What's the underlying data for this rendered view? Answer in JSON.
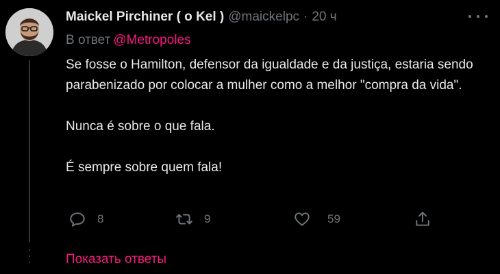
{
  "author": {
    "display_name": "Maickel Pirchiner ( o Kel )",
    "handle": "@maickelpc",
    "separator": "·",
    "time": "20 ч"
  },
  "reply": {
    "prefix": "В ответ",
    "mention": "@Metropoles"
  },
  "body": {
    "line1": "Se fosse o Hamilton, defensor da igualdade e da justiça, estaria sendo parabenizado por colocar a mulher como a melhor \"compra da vida\".",
    "line2": "Nunca é sobre o que fala.",
    "line3": "É sempre sobre quem fala!"
  },
  "actions": {
    "replies": "8",
    "retweets": "9",
    "likes": "59"
  },
  "footer": {
    "show_replies": "Показать ответы"
  },
  "icons": {
    "more": "more-horizontal-icon",
    "reply": "reply-bubble-icon",
    "retweet": "retweet-icon",
    "like": "heart-icon",
    "share": "share-icon"
  },
  "colors": {
    "background": "#000000",
    "text": "#e7e9ea",
    "muted": "#71767b",
    "accent": "#f91880",
    "thread_line": "#333639"
  }
}
